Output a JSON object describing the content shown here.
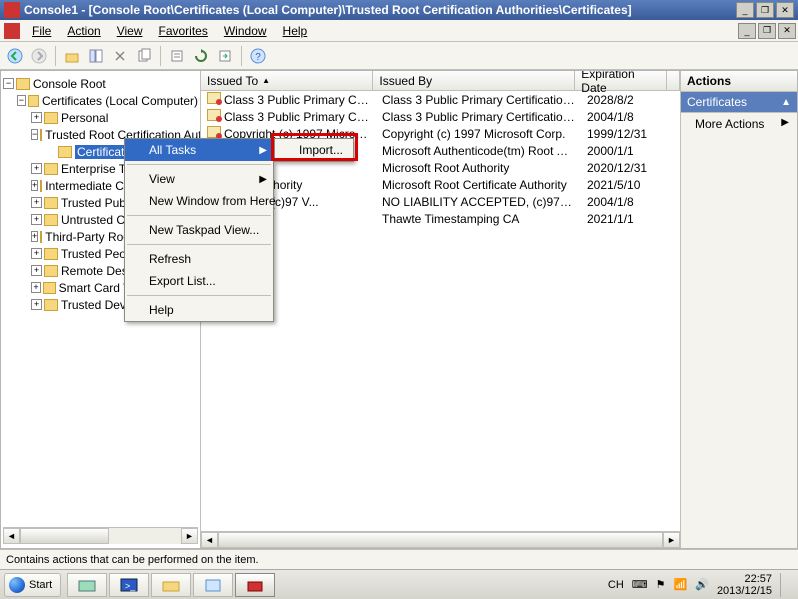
{
  "window": {
    "title": "Console1 - [Console Root\\Certificates (Local Computer)\\Trusted Root Certification Authorities\\Certificates]"
  },
  "menu": {
    "file": "File",
    "action": "Action",
    "view": "View",
    "favorites": "Favorites",
    "window": "Window",
    "help": "Help"
  },
  "tree": {
    "root": "Console Root",
    "certs": "Certificates (Local Computer)",
    "items": [
      "Personal",
      "Trusted Root Certification Authorities",
      "Certificates",
      "Enterprise Trust",
      "Intermediate Certification Authorities",
      "Trusted Publishers",
      "Untrusted Certificates",
      "Third-Party Root Certification Authorities",
      "Trusted People",
      "Remote Desktop",
      "Smart Card Trusted Roots",
      "Trusted Devices"
    ]
  },
  "columns": {
    "issued_to": "Issued To",
    "issued_by": "Issued By",
    "expiration": "Expiration Date"
  },
  "rows": [
    {
      "to": "Class 3 Public Primary Certification...",
      "by": "Class 3 Public Primary Certification A...",
      "exp": "2028/8/2"
    },
    {
      "to": "Class 3 Public Primary Certification...",
      "by": "Class 3 Public Primary Certification A...",
      "exp": "2004/1/8"
    },
    {
      "to": "Copyright (c) 1997 Microsoft Corp.",
      "by": "Copyright (c) 1997 Microsoft Corp.",
      "exp": "1999/12/31"
    },
    {
      "to": "",
      "by": "Microsoft Authenticode(tm) Root Au...",
      "exp": "2000/1/1"
    },
    {
      "to": "thority",
      "by": "Microsoft Root Authority",
      "exp": "2020/12/31"
    },
    {
      "to": "ertificate Authority",
      "by": "Microsoft Root Certificate Authority",
      "exp": "2021/5/10"
    },
    {
      "to": "CCEPTED, (c)97 V...",
      "by": "NO LIABILITY ACCEPTED, (c)97 Veri...",
      "exp": "2004/1/8"
    },
    {
      "to": "mping CA",
      "by": "Thawte Timestamping CA",
      "exp": "2021/1/1"
    }
  ],
  "context": {
    "all_tasks": "All Tasks",
    "view": "View",
    "new_window": "New Window from Here",
    "new_taskpad": "New Taskpad View...",
    "refresh": "Refresh",
    "export_list": "Export List...",
    "help": "Help",
    "import": "Import..."
  },
  "actions_pane": {
    "title": "Actions",
    "subtitle": "Certificates",
    "more": "More Actions"
  },
  "status": "Contains actions that can be performed on the item.",
  "taskbar": {
    "start": "Start",
    "ime": "CH",
    "time": "22:57",
    "date": "2013/12/15"
  }
}
